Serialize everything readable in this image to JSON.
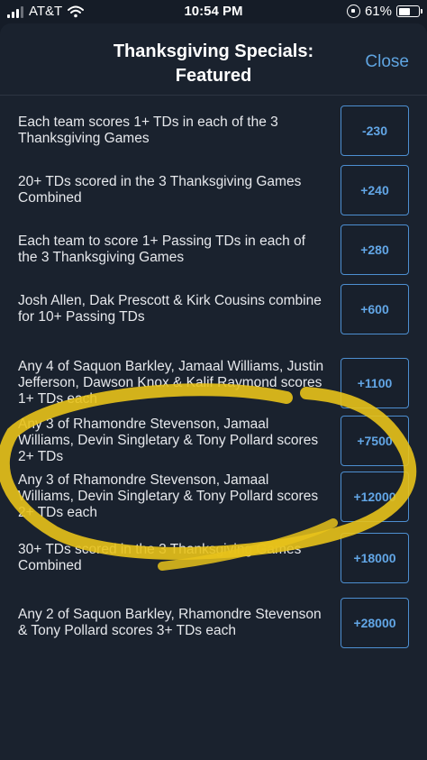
{
  "status_bar": {
    "carrier": "AT&T",
    "time": "10:54 PM",
    "battery": "61%",
    "battery_level": 0.61,
    "icons": [
      "signal-icon",
      "wifi-icon",
      "rotation-lock-icon",
      "battery-icon"
    ]
  },
  "header": {
    "title_line1": "Thanksgiving Specials:",
    "title_line2": "Featured",
    "close_label": "Close"
  },
  "colors": {
    "background": "#1a222e",
    "accent": "#5fa4e0",
    "highlight": "#e8c21a"
  },
  "rows": [
    {
      "text": "Each team scores 1+ TDs in each of the 3 Thanksgiving Games",
      "odds": "-230"
    },
    {
      "text": "20+ TDs scored in the 3 Thanksgiving Games Combined",
      "odds": "+240"
    },
    {
      "text": "Each team to score 1+ Passing TDs in each of the 3 Thanksgiving Games",
      "odds": "+280"
    },
    {
      "text": "Josh Allen, Dak Prescott & Kirk Cousins combine for 10+ Passing TDs",
      "odds": "+600"
    },
    {
      "text": "Any 4 of Saquon Barkley, Jamaal Williams, Justin Jefferson, Dawson Knox & Kalif Raymond scores 1+ TDs each",
      "odds": "+1100"
    },
    {
      "text": "Any 3 of Rhamondre Stevenson, Jamaal Williams, Devin Singletary & Tony Pollard scores 2+ TDs",
      "odds": "+7500"
    },
    {
      "text": "Any 3 of Rhamondre Stevenson, Jamaal Williams, Devin Singletary & Tony Pollard scores 2+ TDs each",
      "odds": "+12000"
    },
    {
      "text": "30+ TDs scored in the 3 Thanksgiving Games Combined",
      "odds": "+18000"
    },
    {
      "text": "Any 2 of Saquon Barkley, Rhamondre Stevenson & Tony Pollard scores 3+ TDs each",
      "odds": "+28000"
    }
  ]
}
